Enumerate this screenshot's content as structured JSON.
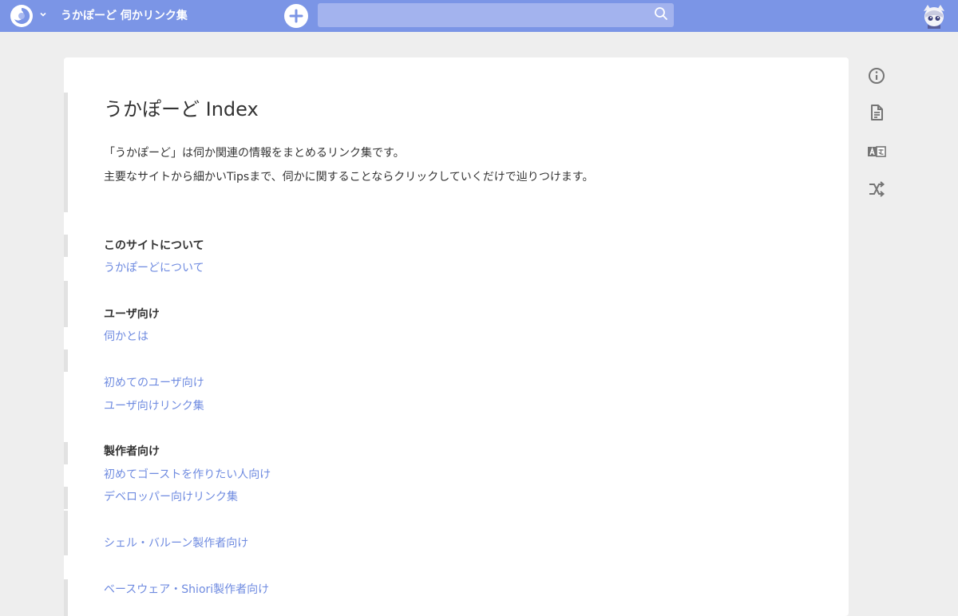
{
  "header": {
    "site_title": "うかぽーど 伺かリンク集",
    "search": {
      "placeholder": "",
      "value": ""
    },
    "colors": {
      "topbar": "#7b95e6",
      "link": "#6f8be0"
    },
    "icons": [
      "logo-icon",
      "chevron-down-icon",
      "add-icon",
      "search-icon",
      "avatar"
    ]
  },
  "page": {
    "title": "うかぽーど Index",
    "intro": [
      "「うかぽーど」は伺か関連の情報をまとめるリンク集です。",
      "主要なサイトから細かいTipsまで、伺かに関することならクリックしていくだけで辿りつけます。"
    ],
    "sections": [
      {
        "heading": "このサイトについて",
        "links": [
          "うかぽーどについて"
        ]
      },
      {
        "heading": "ユーザ向け",
        "links": [
          "伺かとは",
          "初めてのユーザ向け",
          "ユーザ向けリンク集"
        ]
      },
      {
        "heading": "製作者向け",
        "links": [
          "初めてゴーストを作りたい人向け",
          "デベロッパー向けリンク集",
          "シェル・バルーン製作者向け",
          "ベースウェア・Shiori製作者向け"
        ]
      }
    ]
  },
  "sidebar": {
    "icons": [
      "info-icon",
      "document-icon",
      "translate-icon",
      "shuffle-icon"
    ]
  }
}
